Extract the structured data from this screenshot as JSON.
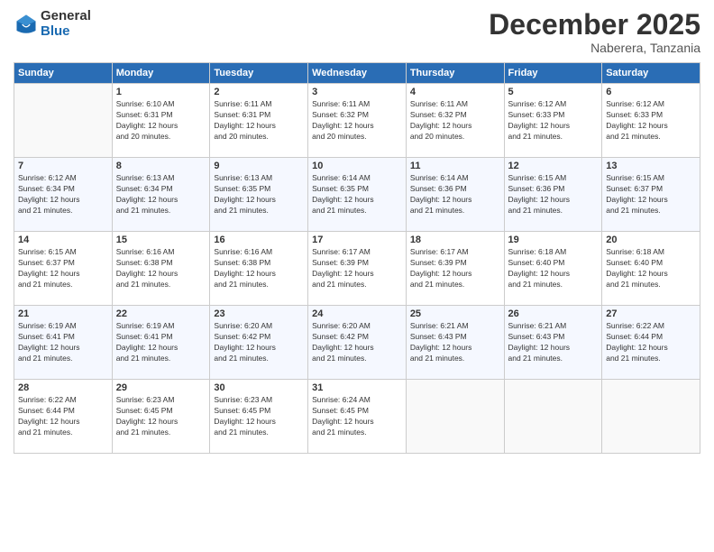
{
  "logo": {
    "general": "General",
    "blue": "Blue"
  },
  "title": "December 2025",
  "subtitle": "Naberera, Tanzania",
  "headers": [
    "Sunday",
    "Monday",
    "Tuesday",
    "Wednesday",
    "Thursday",
    "Friday",
    "Saturday"
  ],
  "weeks": [
    [
      {
        "day": "",
        "info": ""
      },
      {
        "day": "1",
        "info": "Sunrise: 6:10 AM\nSunset: 6:31 PM\nDaylight: 12 hours\nand 20 minutes."
      },
      {
        "day": "2",
        "info": "Sunrise: 6:11 AM\nSunset: 6:31 PM\nDaylight: 12 hours\nand 20 minutes."
      },
      {
        "day": "3",
        "info": "Sunrise: 6:11 AM\nSunset: 6:32 PM\nDaylight: 12 hours\nand 20 minutes."
      },
      {
        "day": "4",
        "info": "Sunrise: 6:11 AM\nSunset: 6:32 PM\nDaylight: 12 hours\nand 20 minutes."
      },
      {
        "day": "5",
        "info": "Sunrise: 6:12 AM\nSunset: 6:33 PM\nDaylight: 12 hours\nand 21 minutes."
      },
      {
        "day": "6",
        "info": "Sunrise: 6:12 AM\nSunset: 6:33 PM\nDaylight: 12 hours\nand 21 minutes."
      }
    ],
    [
      {
        "day": "7",
        "info": "Sunrise: 6:12 AM\nSunset: 6:34 PM\nDaylight: 12 hours\nand 21 minutes."
      },
      {
        "day": "8",
        "info": "Sunrise: 6:13 AM\nSunset: 6:34 PM\nDaylight: 12 hours\nand 21 minutes."
      },
      {
        "day": "9",
        "info": "Sunrise: 6:13 AM\nSunset: 6:35 PM\nDaylight: 12 hours\nand 21 minutes."
      },
      {
        "day": "10",
        "info": "Sunrise: 6:14 AM\nSunset: 6:35 PM\nDaylight: 12 hours\nand 21 minutes."
      },
      {
        "day": "11",
        "info": "Sunrise: 6:14 AM\nSunset: 6:36 PM\nDaylight: 12 hours\nand 21 minutes."
      },
      {
        "day": "12",
        "info": "Sunrise: 6:15 AM\nSunset: 6:36 PM\nDaylight: 12 hours\nand 21 minutes."
      },
      {
        "day": "13",
        "info": "Sunrise: 6:15 AM\nSunset: 6:37 PM\nDaylight: 12 hours\nand 21 minutes."
      }
    ],
    [
      {
        "day": "14",
        "info": "Sunrise: 6:15 AM\nSunset: 6:37 PM\nDaylight: 12 hours\nand 21 minutes."
      },
      {
        "day": "15",
        "info": "Sunrise: 6:16 AM\nSunset: 6:38 PM\nDaylight: 12 hours\nand 21 minutes."
      },
      {
        "day": "16",
        "info": "Sunrise: 6:16 AM\nSunset: 6:38 PM\nDaylight: 12 hours\nand 21 minutes."
      },
      {
        "day": "17",
        "info": "Sunrise: 6:17 AM\nSunset: 6:39 PM\nDaylight: 12 hours\nand 21 minutes."
      },
      {
        "day": "18",
        "info": "Sunrise: 6:17 AM\nSunset: 6:39 PM\nDaylight: 12 hours\nand 21 minutes."
      },
      {
        "day": "19",
        "info": "Sunrise: 6:18 AM\nSunset: 6:40 PM\nDaylight: 12 hours\nand 21 minutes."
      },
      {
        "day": "20",
        "info": "Sunrise: 6:18 AM\nSunset: 6:40 PM\nDaylight: 12 hours\nand 21 minutes."
      }
    ],
    [
      {
        "day": "21",
        "info": "Sunrise: 6:19 AM\nSunset: 6:41 PM\nDaylight: 12 hours\nand 21 minutes."
      },
      {
        "day": "22",
        "info": "Sunrise: 6:19 AM\nSunset: 6:41 PM\nDaylight: 12 hours\nand 21 minutes."
      },
      {
        "day": "23",
        "info": "Sunrise: 6:20 AM\nSunset: 6:42 PM\nDaylight: 12 hours\nand 21 minutes."
      },
      {
        "day": "24",
        "info": "Sunrise: 6:20 AM\nSunset: 6:42 PM\nDaylight: 12 hours\nand 21 minutes."
      },
      {
        "day": "25",
        "info": "Sunrise: 6:21 AM\nSunset: 6:43 PM\nDaylight: 12 hours\nand 21 minutes."
      },
      {
        "day": "26",
        "info": "Sunrise: 6:21 AM\nSunset: 6:43 PM\nDaylight: 12 hours\nand 21 minutes."
      },
      {
        "day": "27",
        "info": "Sunrise: 6:22 AM\nSunset: 6:44 PM\nDaylight: 12 hours\nand 21 minutes."
      }
    ],
    [
      {
        "day": "28",
        "info": "Sunrise: 6:22 AM\nSunset: 6:44 PM\nDaylight: 12 hours\nand 21 minutes."
      },
      {
        "day": "29",
        "info": "Sunrise: 6:23 AM\nSunset: 6:45 PM\nDaylight: 12 hours\nand 21 minutes."
      },
      {
        "day": "30",
        "info": "Sunrise: 6:23 AM\nSunset: 6:45 PM\nDaylight: 12 hours\nand 21 minutes."
      },
      {
        "day": "31",
        "info": "Sunrise: 6:24 AM\nSunset: 6:45 PM\nDaylight: 12 hours\nand 21 minutes."
      },
      {
        "day": "",
        "info": ""
      },
      {
        "day": "",
        "info": ""
      },
      {
        "day": "",
        "info": ""
      }
    ]
  ]
}
